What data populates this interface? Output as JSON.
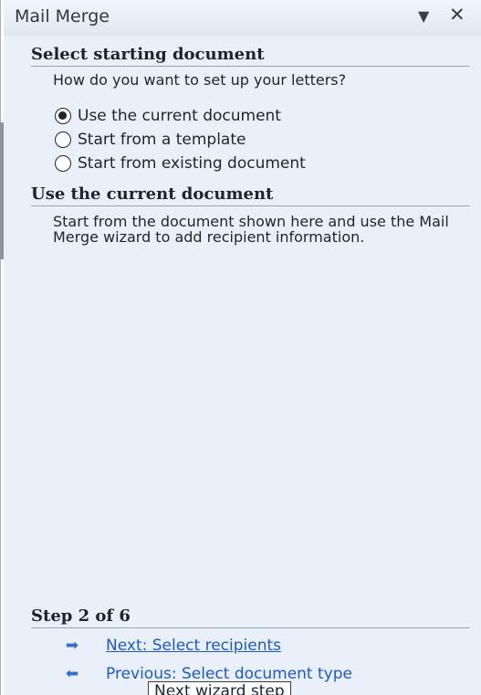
{
  "pane": {
    "title": "Mail Merge",
    "dropdown_icon": "chevron-down-icon",
    "close_icon": "close-icon"
  },
  "section_select": {
    "heading": "Select starting document",
    "question": "How do you want to set up your letters?",
    "options": [
      {
        "label": "Use the current document",
        "checked": true
      },
      {
        "label": "Start from a template",
        "checked": false
      },
      {
        "label": "Start from existing document",
        "checked": false
      }
    ]
  },
  "section_current": {
    "heading": "Use the current document",
    "description": "Start from the document shown here and use the Mail Merge wizard to add recipient information."
  },
  "step": {
    "heading": "Step 2 of 6",
    "next_label": "Next: Select recipients",
    "previous_label": "Previous: Select document type",
    "next_icon": "arrow-right-icon",
    "previous_icon": "arrow-left-icon"
  },
  "tooltip": {
    "text": "Next wizard step"
  },
  "colors": {
    "pane_background": "#e9f0fa",
    "link": "#1b59c4",
    "arrow": "#2f6fd0"
  }
}
